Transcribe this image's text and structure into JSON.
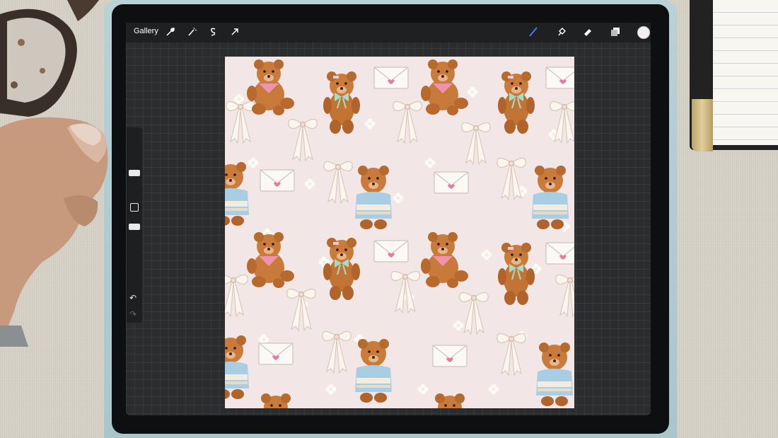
{
  "app": {
    "gallery_label": "Gallery",
    "tools_left": [
      "wrench-icon",
      "magic-wand-icon",
      "selection-s-icon",
      "transform-arrow-icon"
    ],
    "tools_right": [
      "brush-icon",
      "smudge-icon",
      "eraser-icon",
      "layers-icon"
    ],
    "active_color": "#f4eff0",
    "accent_color": "#3b82f6"
  },
  "sidebar": {
    "undo_glyph": "↶",
    "redo_glyph": "↷"
  },
  "canvas": {
    "background_color": "#f2e7e6",
    "pattern_elements": [
      "teddy-bear",
      "bow",
      "envelope-with-heart",
      "flower"
    ]
  }
}
